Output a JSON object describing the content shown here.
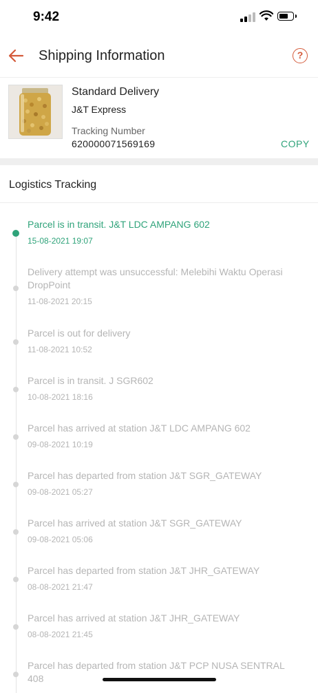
{
  "status_bar": {
    "time": "9:42"
  },
  "header": {
    "title": "Shipping Information",
    "help_glyph": "?"
  },
  "shipment": {
    "delivery_type": "Standard Delivery",
    "carrier": "J&T Express",
    "tracking_label": "Tracking Number",
    "tracking_number": "620000071569169",
    "copy_label": "COPY"
  },
  "logistics": {
    "title": "Logistics Tracking",
    "events": [
      {
        "message": "Parcel is in transit. J&T LDC AMPANG 602",
        "time": "15-08-2021 19:07",
        "active": true
      },
      {
        "message": "Delivery attempt was unsuccessful: Melebihi Waktu Operasi DropPoint",
        "time": "11-08-2021 20:15",
        "active": false
      },
      {
        "message": "Parcel is out for delivery",
        "time": "11-08-2021 10:52",
        "active": false
      },
      {
        "message": "Parcel is in transit. J SGR602",
        "time": "10-08-2021 18:16",
        "active": false
      },
      {
        "message": "Parcel has arrived at station J&T LDC AMPANG 602",
        "time": "09-08-2021 10:19",
        "active": false
      },
      {
        "message": "Parcel has departed from station J&T SGR_GATEWAY",
        "time": "09-08-2021 05:27",
        "active": false
      },
      {
        "message": "Parcel has arrived at station J&T SGR_GATEWAY",
        "time": "09-08-2021 05:06",
        "active": false
      },
      {
        "message": "Parcel has departed from station J&T JHR_GATEWAY",
        "time": "08-08-2021 21:47",
        "active": false
      },
      {
        "message": "Parcel has arrived at station J&T JHR_GATEWAY",
        "time": "08-08-2021 21:45",
        "active": false
      },
      {
        "message": "Parcel has departed from station J&T PCP NUSA SENTRAL 408",
        "time": "",
        "active": false
      }
    ]
  },
  "colors": {
    "accent": "#2fa37a",
    "brand": "#d45a3a",
    "muted": "#b5b5b5"
  },
  "icons": {
    "back": "arrow-left-icon",
    "help": "question-circle-icon"
  }
}
